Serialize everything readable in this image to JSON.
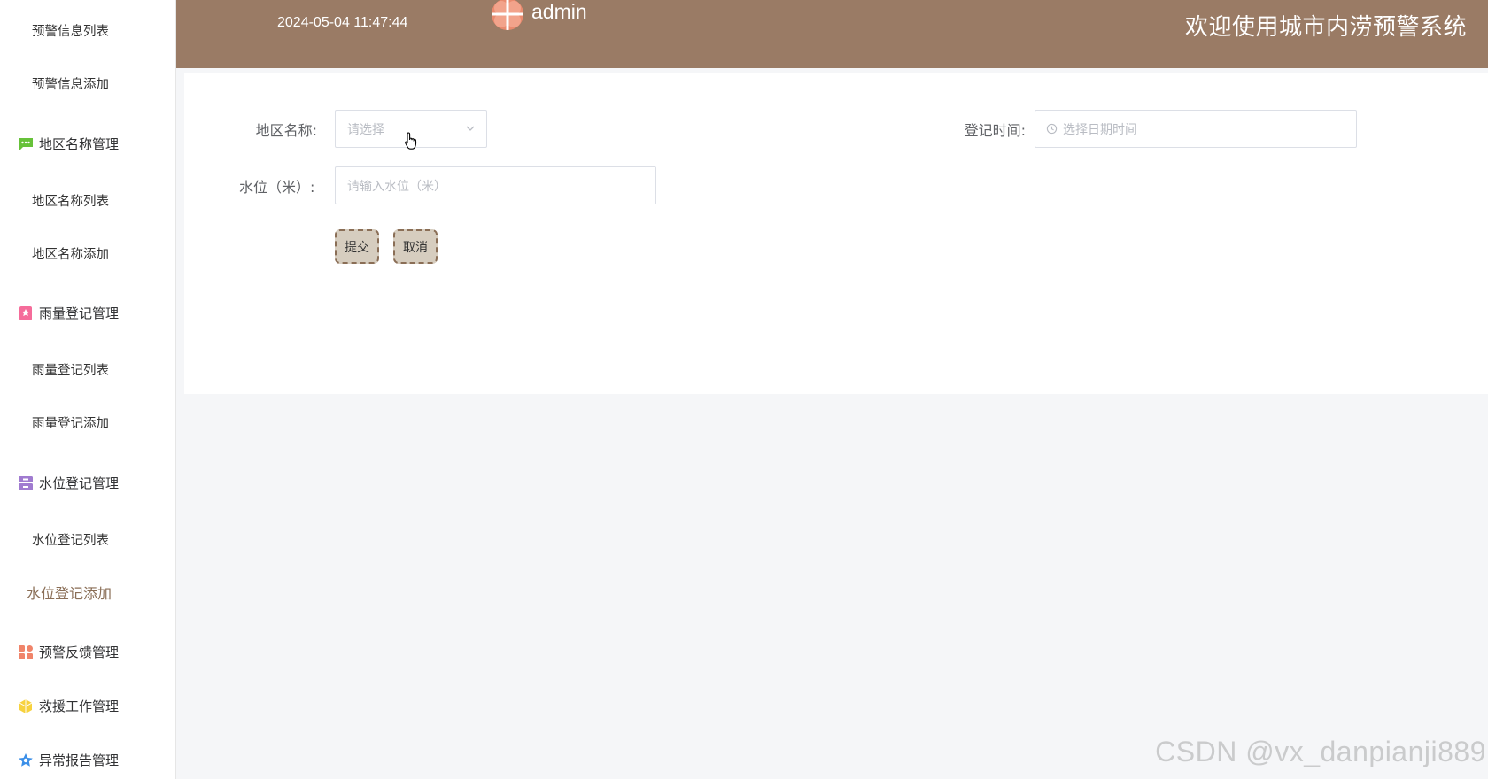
{
  "sidebar": {
    "items": [
      {
        "type": "sub",
        "label": "预警信息列表"
      },
      {
        "type": "sub",
        "label": "预警信息添加"
      },
      {
        "type": "group",
        "label": "地区名称管理",
        "icon": "chat-bubble-icon",
        "color": "#67c23a"
      },
      {
        "type": "sub",
        "label": "地区名称列表"
      },
      {
        "type": "sub",
        "label": "地区名称添加"
      },
      {
        "type": "group",
        "label": "雨量登记管理",
        "icon": "badge-icon",
        "color": "#f56c9a"
      },
      {
        "type": "sub",
        "label": "雨量登记列表"
      },
      {
        "type": "sub",
        "label": "雨量登记添加"
      },
      {
        "type": "group",
        "label": "水位登记管理",
        "icon": "archive-icon",
        "color": "#a07bd0"
      },
      {
        "type": "sub",
        "label": "水位登记列表"
      },
      {
        "type": "sub",
        "label": "水位登记添加",
        "active": true
      },
      {
        "type": "group",
        "label": "预警反馈管理",
        "icon": "grid-icon",
        "color": "#f0846a"
      },
      {
        "type": "group",
        "label": "救援工作管理",
        "icon": "hexagon-icon",
        "color": "#f7d23e"
      },
      {
        "type": "group",
        "label": "异常报告管理",
        "icon": "star-icon",
        "color": "#3b8fe8"
      }
    ]
  },
  "header": {
    "datetime": "2024-05-04 11:47:44",
    "username": "admin",
    "title": "欢迎使用城市内涝预警系统",
    "bg_color": "#9a7b65"
  },
  "form": {
    "region_label": "地区名称:",
    "region_placeholder": "请选择",
    "time_label": "登记时间:",
    "time_placeholder": "选择日期时间",
    "level_label": "水位（米）:",
    "level_placeholder": "请输入水位（米）",
    "submit_label": "提交",
    "cancel_label": "取消"
  },
  "watermark": "CSDN @vx_danpianji889"
}
